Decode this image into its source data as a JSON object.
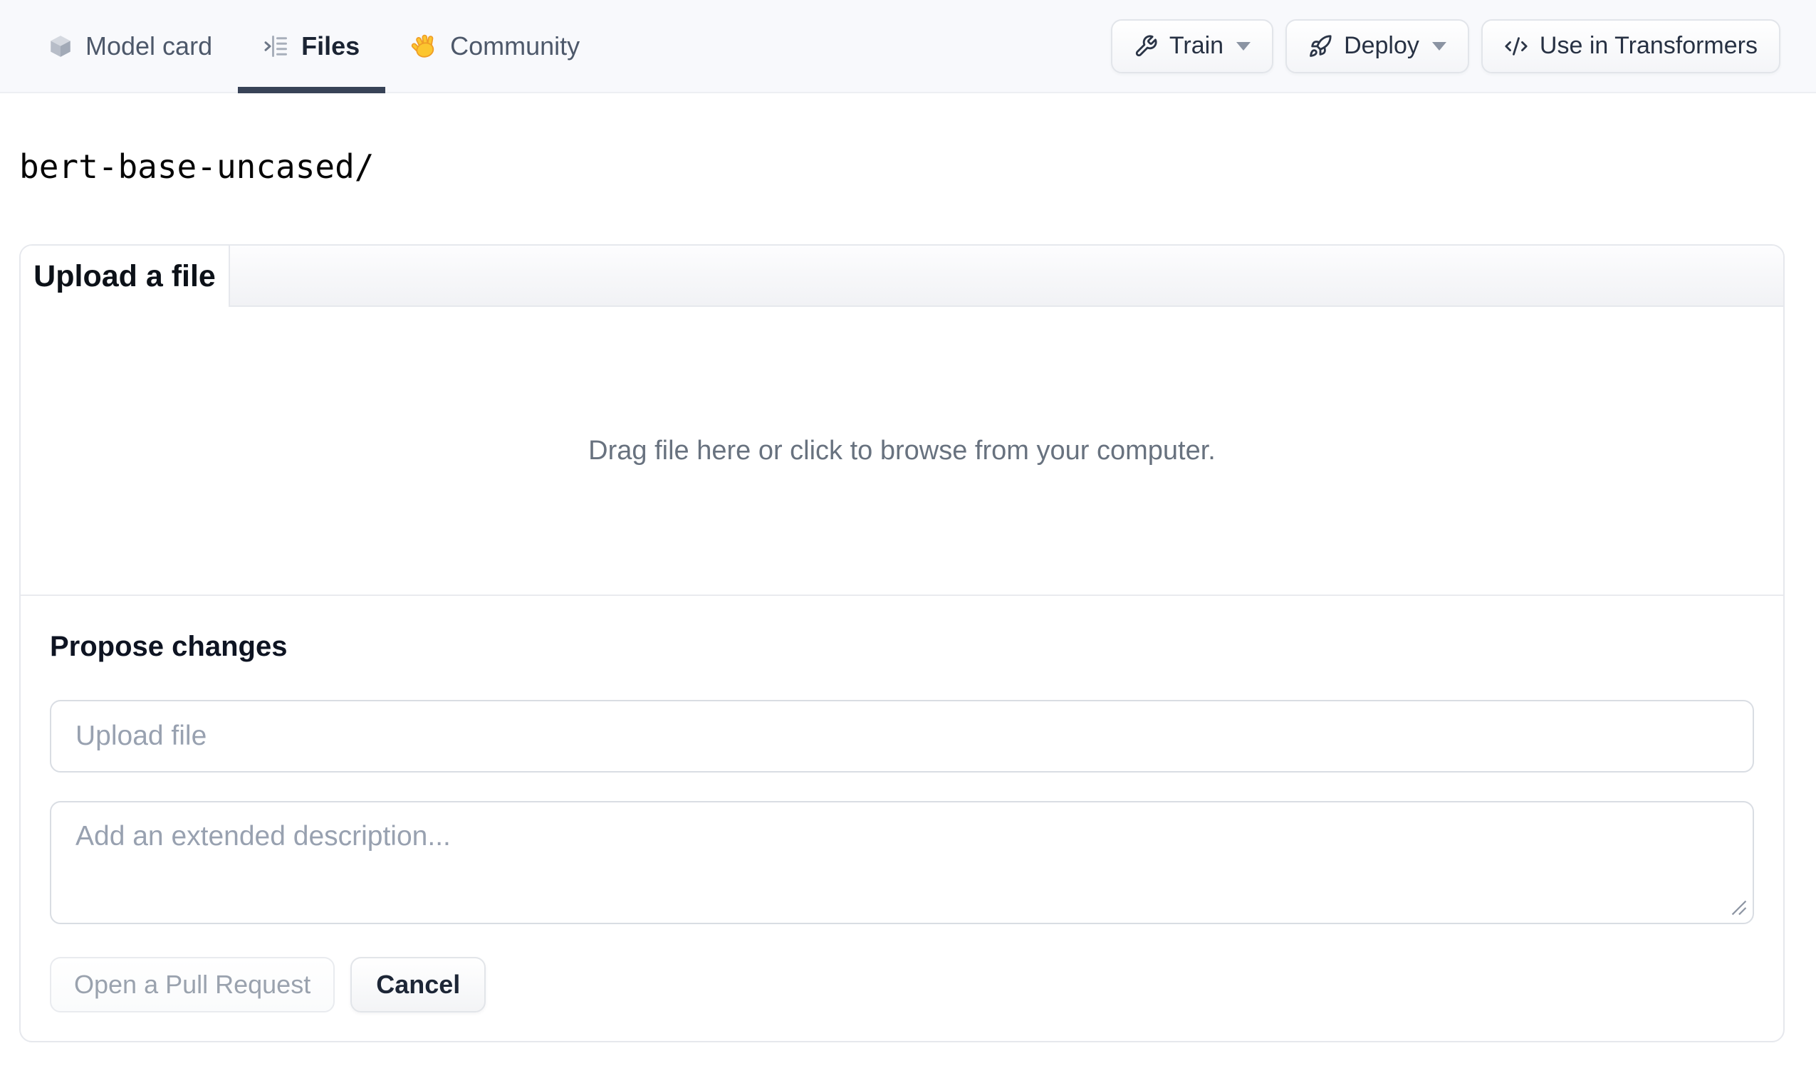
{
  "nav": {
    "tabs": [
      {
        "label": "Model card",
        "icon": "cube-icon",
        "active": false
      },
      {
        "label": "Files",
        "icon": "files-icon",
        "active": true
      },
      {
        "label": "Community",
        "icon": "wave-icon",
        "active": false
      }
    ],
    "actions": [
      {
        "label": "Train",
        "icon": "wrench-icon",
        "has_caret": true
      },
      {
        "label": "Deploy",
        "icon": "rocket-icon",
        "has_caret": true
      },
      {
        "label": "Use in Transformers",
        "icon": "code-icon",
        "has_caret": false
      }
    ]
  },
  "repo": {
    "path": "bert-base-uncased/"
  },
  "upload_card": {
    "tab_label": "Upload a file",
    "dropzone_text": "Drag file here or click to browse from your computer.",
    "propose": {
      "heading": "Propose changes",
      "filename_placeholder": "Upload file",
      "description_placeholder": "Add an extended description...",
      "submit_label": "Open a Pull Request",
      "cancel_label": "Cancel"
    }
  },
  "colors": {
    "navbar_bg": "#f8f9fc",
    "active_tab_underline": "#384357",
    "card_border": "#e6e8ed",
    "input_border": "#d9dde3",
    "muted_text": "#68727f",
    "placeholder_text": "#98a1b0",
    "disabled_text": "#9aa2ae",
    "dark_text": "#1b2433",
    "wave_yellow": "#fcc62f"
  }
}
